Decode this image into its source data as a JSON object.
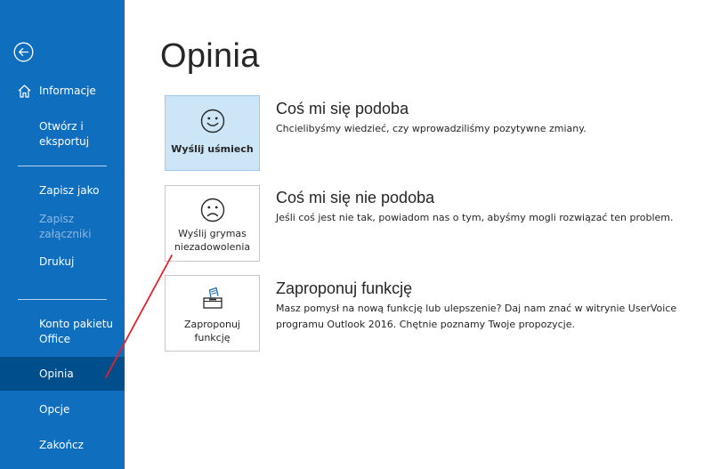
{
  "sidebar": {
    "items": {
      "informacje": "Informacje",
      "otworz_line1": "Otwórz i",
      "otworz_line2": "eksportuj",
      "zapisz_jako": "Zapisz jako",
      "zapisz_zalaczniki": "Zapisz załączniki",
      "drukuj": "Drukuj",
      "konto_line1": "Konto pakietu",
      "konto_line2": "Office",
      "opinia": "Opinia",
      "opcje": "Opcje",
      "zakoncz": "Zakończ"
    }
  },
  "main": {
    "title": "Opinia",
    "options": {
      "like": {
        "tile_label": "Wyślij uśmiech",
        "title": "Coś mi się podoba",
        "desc": "Chcielibyśmy wiedzieć, czy wprowadziliśmy pozytywne zmiany."
      },
      "dislike": {
        "tile_label_line1": "Wyślij grymas",
        "tile_label_line2": "niezadowolenia",
        "title": "Coś mi się nie podoba",
        "desc": "Jeśli coś jest nie tak, powiadom nas o tym, abyśmy mogli rozwiązać ten problem."
      },
      "suggest": {
        "tile_label_line1": "Zaproponuj",
        "tile_label_line2": "funkcję",
        "title": "Zaproponuj funkcję",
        "desc_line1": "Masz pomysł na nową funkcję lub ulepszenie? Daj nam znać w witrynie UserVoice",
        "desc_line2": "programu Outlook 2016. Chętnie poznamy Twoje propozycje."
      }
    }
  },
  "icons": {
    "back": "back-arrow-circle-icon",
    "home": "home-icon",
    "smile": "smile-face-icon",
    "frown": "frown-face-icon",
    "suggest": "suggestion-box-icon"
  },
  "colors": {
    "sidebar_bg": "#106ebe",
    "sidebar_active": "#004e8c",
    "tile_selected": "#cde6f7",
    "annotation": "#e8202a"
  }
}
